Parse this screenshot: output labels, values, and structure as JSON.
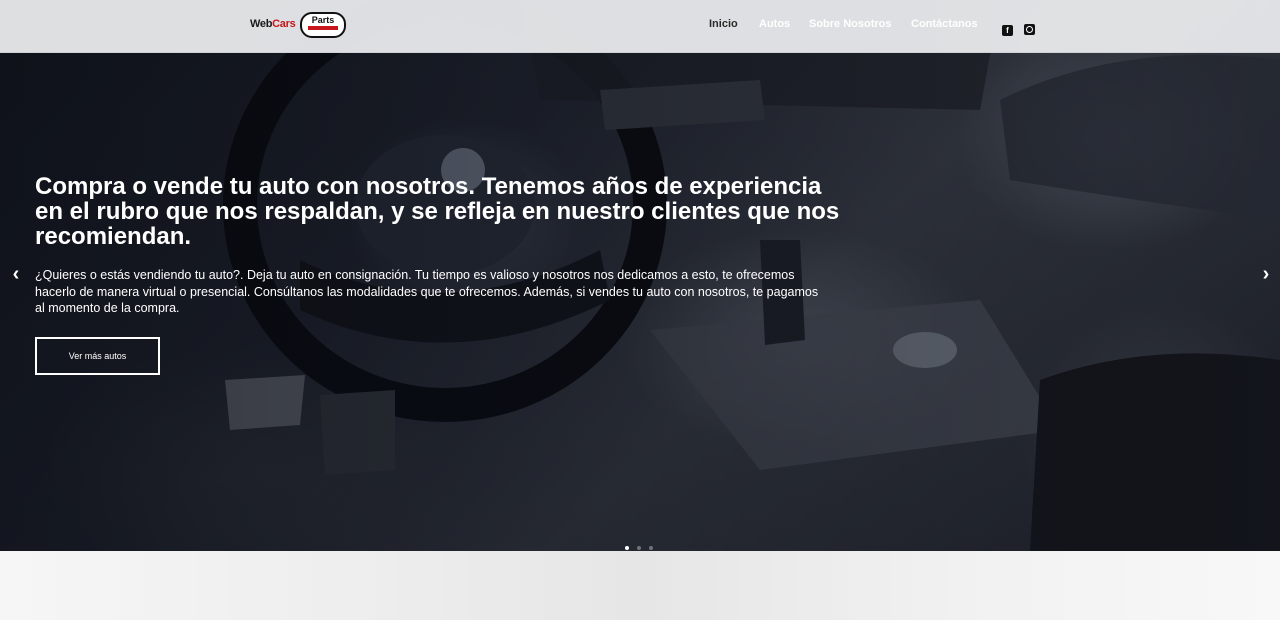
{
  "brand": {
    "name_part1": "Web",
    "name_part2": "Cars",
    "badge_top": "Parts",
    "badge_bottom": "Cars"
  },
  "nav": {
    "items": [
      {
        "label": "Inicio",
        "active": true
      },
      {
        "label": "Autos",
        "active": false
      },
      {
        "label": "Sobre Nosotros",
        "active": false
      },
      {
        "label": "Contáctanos",
        "active": false
      }
    ],
    "social": [
      "facebook-icon",
      "instagram-icon"
    ]
  },
  "hero": {
    "headline": "Compra o vende tu auto con nosotros. Tenemos años de experiencia en el rubro que nos respaldan, y se refleja en nuestro clientes que nos recomiendan.",
    "description": "¿Quieres o estás vendiendo tu auto?. Deja tu auto en consignación. Tu tiempo es valioso y nosotros nos dedicamos a esto, te ofrecemos hacerlo de manera virtual o presencial. Consúltanos las modalidades que te ofrecemos. Además, si vendes tu auto con nosotros, te pagamos al momento de la compra.",
    "cta_label": "Ver más autos",
    "prev_arrow": "‹",
    "next_arrow": "›",
    "slides_count": 3,
    "active_slide": 1
  },
  "colors": {
    "accent": "#c8161d",
    "header_bg": "#ebecee",
    "text_light": "#ffffff",
    "active_nav": "#2b2b2b"
  }
}
